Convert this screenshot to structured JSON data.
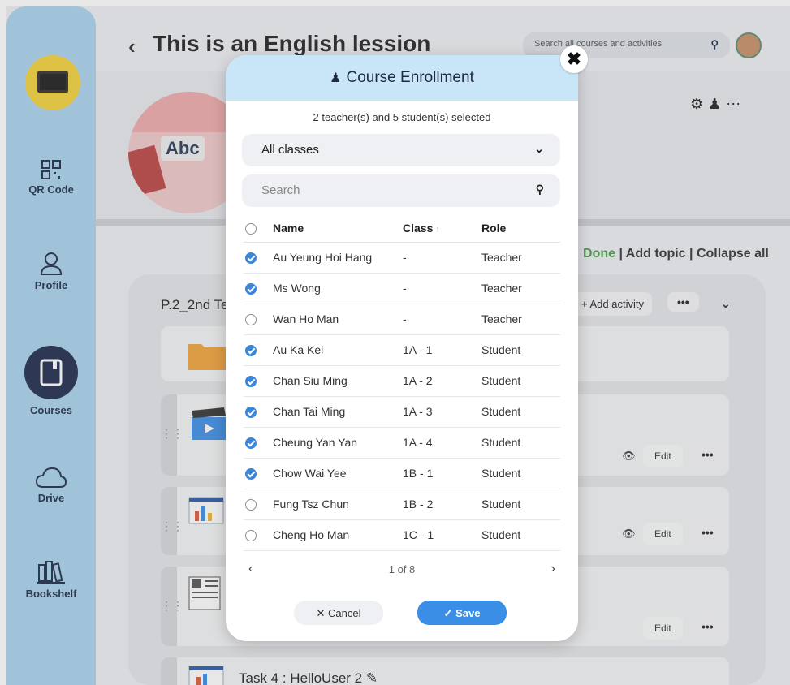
{
  "page": {
    "title": "This is an English lession"
  },
  "search": {
    "placeholder": "Search all courses and activities"
  },
  "sidebar": {
    "items": [
      {
        "label": "QR Code",
        "icon": "qr-code-icon"
      },
      {
        "label": "Profile",
        "icon": "profile-icon"
      },
      {
        "label": "Courses",
        "icon": "courses-icon"
      },
      {
        "label": "Drive",
        "icon": "cloud-icon"
      },
      {
        "label": "Bookshelf",
        "icon": "bookshelf-icon"
      }
    ]
  },
  "hero": {
    "image_text": "Abc"
  },
  "toolbar": {
    "done": "Done",
    "sep": "|",
    "add_topic": "Add topic",
    "collapse_all": "Collapse all"
  },
  "section": {
    "title": "P.2_2nd Te",
    "add_activity": "Add activity",
    "more": "•••",
    "edit": "Edit",
    "task4_title": "Task 4 : HelloUser 2"
  },
  "modal": {
    "title": "Course Enrollment",
    "summary": "2 teacher(s) and 5 student(s) selected",
    "class_filter": "All classes",
    "search_placeholder": "Search",
    "columns": {
      "name": "Name",
      "class": "Class",
      "role": "Role"
    },
    "rows": [
      {
        "name": "Au Yeung Hoi Hang",
        "class": "-",
        "role": "Teacher",
        "checked": true
      },
      {
        "name": "Ms Wong",
        "class": "-",
        "role": "Teacher",
        "checked": true
      },
      {
        "name": "Wan Ho Man",
        "class": "-",
        "role": "Teacher",
        "checked": false
      },
      {
        "name": "Au Ka Kei",
        "class": "1A - 1",
        "role": "Student",
        "checked": true
      },
      {
        "name": "Chan Siu Ming",
        "class": "1A - 2",
        "role": "Student",
        "checked": true
      },
      {
        "name": "Chan Tai Ming",
        "class": "1A - 3",
        "role": "Student",
        "checked": true
      },
      {
        "name": "Cheung Yan Yan",
        "class": "1A - 4",
        "role": "Student",
        "checked": true
      },
      {
        "name": "Chow Wai Yee",
        "class": "1B - 1",
        "role": "Student",
        "checked": true
      },
      {
        "name": "Fung Tsz Chun",
        "class": "1B - 2",
        "role": "Student",
        "checked": false
      },
      {
        "name": "Cheng Ho Man",
        "class": "1C - 1",
        "role": "Student",
        "checked": false
      }
    ],
    "pagination": "1 of 8",
    "cancel": "Cancel",
    "save": "Save"
  },
  "colors": {
    "sidebar": "#a9d4ee",
    "modal_header": "#c9e6f8",
    "accent": "#3a8ee6",
    "done": "#4a9b4a"
  }
}
